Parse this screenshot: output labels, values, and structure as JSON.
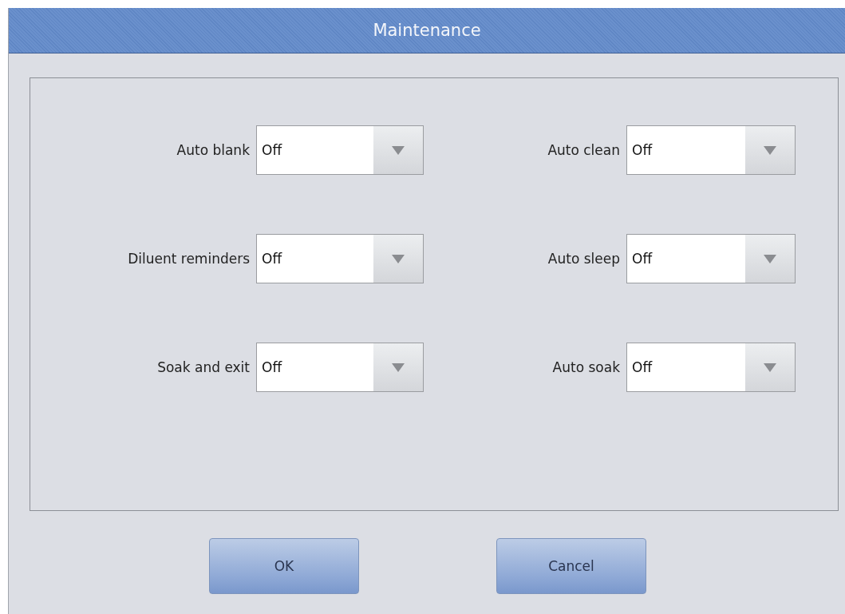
{
  "window": {
    "title": "Maintenance"
  },
  "settings": [
    {
      "label": "Auto blank",
      "value": "Off"
    },
    {
      "label": "Auto clean",
      "value": "Off"
    },
    {
      "label": "Diluent reminders",
      "value": "Off"
    },
    {
      "label": "Auto sleep",
      "value": "Off"
    },
    {
      "label": "Soak and exit",
      "value": "Off"
    },
    {
      "label": "Auto soak",
      "value": "Off"
    }
  ],
  "buttons": [
    "OK",
    "Cancel"
  ]
}
